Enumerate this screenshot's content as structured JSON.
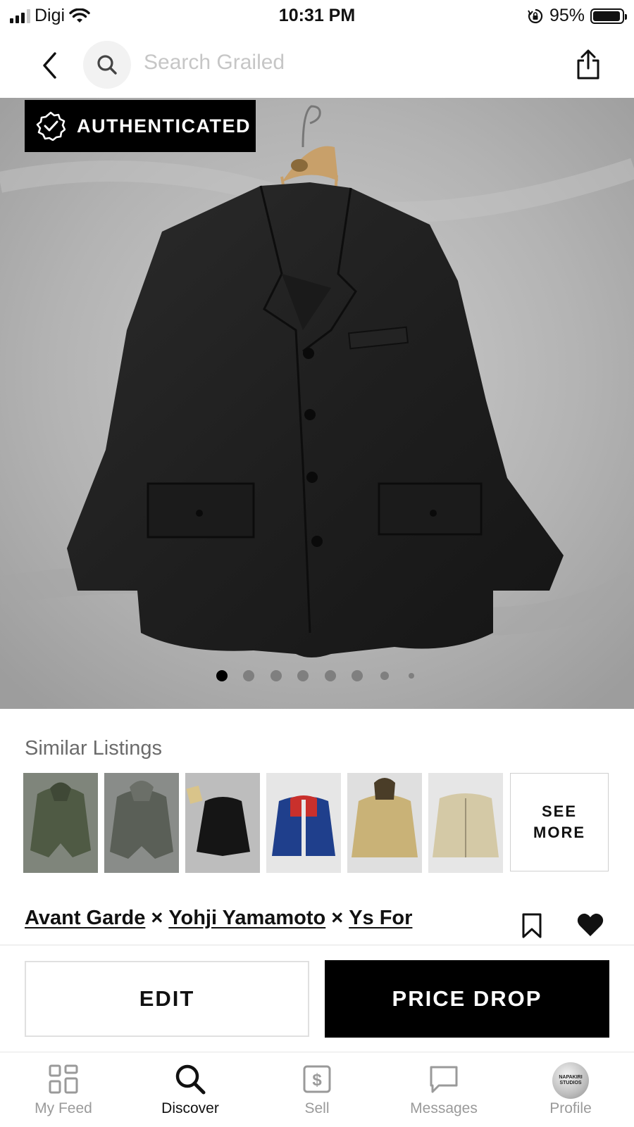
{
  "status_bar": {
    "carrier": "Digi",
    "time": "10:31 PM",
    "battery": "95%",
    "battery_level": 0.95,
    "icons": [
      "signal-icon",
      "wifi-icon",
      "orientation-lock-icon",
      "battery-icon"
    ]
  },
  "nav": {
    "search_placeholder": "Search Grailed",
    "icons": [
      "back-icon",
      "search-icon",
      "share-icon"
    ]
  },
  "hero": {
    "badge_label": "AUTHENTICATED",
    "image_count": 8,
    "active_image": 1
  },
  "similar": {
    "title": "Similar Listings",
    "see_more_line1": "SEE",
    "see_more_line2": "MORE",
    "thumbnails": [
      {
        "subject": "olive hooded jacket"
      },
      {
        "subject": "grey hooded jacket"
      },
      {
        "subject": "black jacket"
      },
      {
        "subject": "blue track jacket"
      },
      {
        "subject": "khaki hooded parka"
      },
      {
        "subject": "beige zip jacket"
      }
    ]
  },
  "listing": {
    "brands": [
      "Avant Garde",
      "Yohji Yamamoto",
      "Ys For"
    ],
    "separator": "×"
  },
  "actions": {
    "edit_label": "EDIT",
    "price_drop_label": "PRICE DROP"
  },
  "tabs": [
    {
      "label": "My Feed",
      "icon": "feed-icon",
      "active": false
    },
    {
      "label": "Discover",
      "icon": "search-icon",
      "active": true
    },
    {
      "label": "Sell",
      "icon": "dollar-tag-icon",
      "active": false
    },
    {
      "label": "Messages",
      "icon": "chat-bubble-icon",
      "active": false
    },
    {
      "label": "Profile",
      "icon": "avatar",
      "active": false
    }
  ],
  "avatar_text": [
    "NAPAKIRI",
    "STUDIOS"
  ],
  "colors": {
    "primary": "#000000",
    "muted_text": "#9a9a9a",
    "placeholder": "#c6c6c6"
  }
}
